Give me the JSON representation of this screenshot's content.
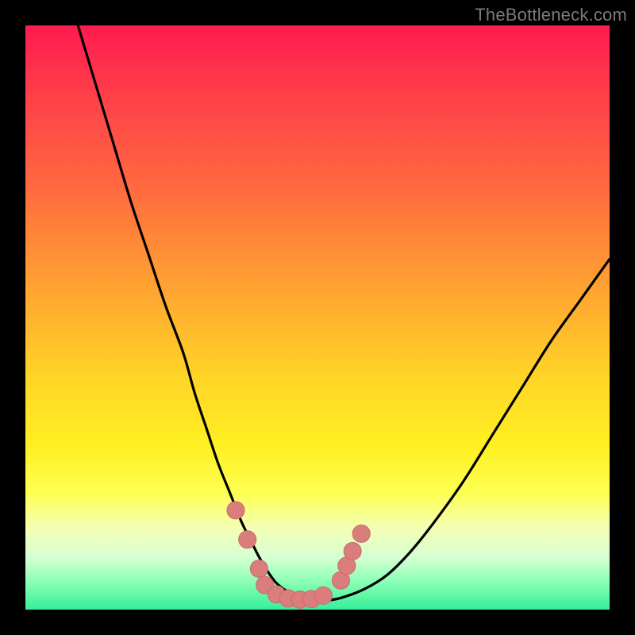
{
  "watermark": "TheBottleneck.com",
  "colors": {
    "frame": "#000000",
    "curve": "#000000",
    "marker_fill": "#d97d7d",
    "marker_stroke": "#c96a6a",
    "gradient_stops": [
      {
        "pct": 0,
        "hex": "#ff1a4f"
      },
      {
        "pct": 12,
        "hex": "#ff3f49"
      },
      {
        "pct": 28,
        "hex": "#ff6a3f"
      },
      {
        "pct": 45,
        "hex": "#ffa331"
      },
      {
        "pct": 60,
        "hex": "#ffd427"
      },
      {
        "pct": 72,
        "hex": "#fff021"
      },
      {
        "pct": 80,
        "hex": "#fdff52"
      },
      {
        "pct": 86,
        "hex": "#f4ffb4"
      },
      {
        "pct": 91,
        "hex": "#d6ffd2"
      },
      {
        "pct": 95,
        "hex": "#8fffb7"
      },
      {
        "pct": 100,
        "hex": "#35ef9a"
      }
    ]
  },
  "chart_data": {
    "type": "line",
    "title": "",
    "xlabel": "",
    "ylabel": "",
    "xlim": [
      0,
      100
    ],
    "ylim": [
      0,
      100
    ],
    "note": "V-shaped bottleneck curve; x/y in percent of plot area (y = 0 is bottom).",
    "series": [
      {
        "name": "bottleneck-curve",
        "x": [
          9,
          12,
          15,
          18,
          21,
          24,
          27,
          29,
          31,
          33,
          35,
          37,
          38.5,
          40,
          41.5,
          43,
          45,
          47,
          49,
          51,
          54,
          58,
          62,
          66,
          70,
          75,
          80,
          85,
          90,
          95,
          100
        ],
        "y": [
          100,
          90,
          80,
          70,
          61,
          52,
          44,
          37,
          31,
          25,
          20,
          15,
          12,
          9,
          6.5,
          4.5,
          3,
          2,
          1.5,
          1.5,
          2,
          3.5,
          6,
          10,
          15,
          22,
          30,
          38,
          46,
          53,
          60
        ]
      }
    ],
    "markers": {
      "name": "highlighted-points",
      "shape": "circle",
      "approx_radius_pct": 1.5,
      "points": [
        {
          "x": 36,
          "y": 17
        },
        {
          "x": 38,
          "y": 12
        },
        {
          "x": 40,
          "y": 7
        },
        {
          "x": 41,
          "y": 4.2
        },
        {
          "x": 43,
          "y": 2.6
        },
        {
          "x": 45,
          "y": 1.9
        },
        {
          "x": 47,
          "y": 1.7
        },
        {
          "x": 49,
          "y": 1.8
        },
        {
          "x": 51,
          "y": 2.4
        },
        {
          "x": 54,
          "y": 5
        },
        {
          "x": 55,
          "y": 7.5
        },
        {
          "x": 56,
          "y": 10
        },
        {
          "x": 57.5,
          "y": 13
        }
      ]
    }
  }
}
